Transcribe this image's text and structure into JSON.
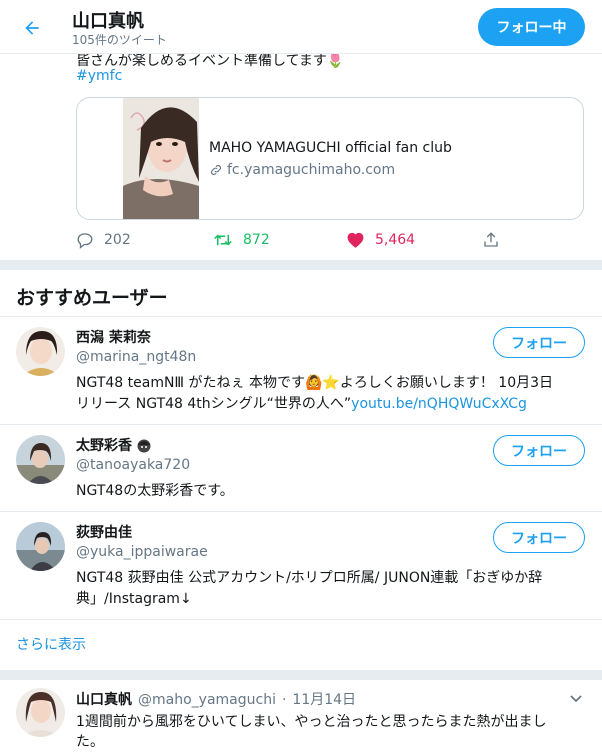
{
  "header": {
    "title": "山口真帆",
    "subtitle": "105件のツイート",
    "follow_label": "フォロー中"
  },
  "tweet": {
    "cut_text": "皆さんが楽しめるイベント準備してます🌷",
    "hashtag": "#ymfc",
    "card": {
      "title": "MAHO YAMAGUCHI official fan club",
      "domain": "fc.yamaguchimaho.com"
    },
    "replies": "202",
    "retweets": "872",
    "likes": "5,464"
  },
  "recommended": {
    "title": "おすすめユーザー",
    "more_label": "さらに表示",
    "users": [
      {
        "name": "西潟 茉莉奈",
        "handle": "@marina_ngt48n",
        "follow_label": "フォロー",
        "bio_line1": "NGT48 teamNⅢ がたねぇ 本物です🙆⭐よろしくお願いします！ 10月3日",
        "bio_line2_text": "リリース NGT48 4thシングル“世界の人へ”",
        "bio_link": "youtu.be/nQHQWuCxXCg"
      },
      {
        "name": "太野彩香",
        "handle": "@tanoayaka720",
        "follow_label": "フォロー",
        "bio_line1": "NGT48の太野彩香です。"
      },
      {
        "name": "荻野由佳",
        "handle": "@yuka_ippaiwarae",
        "follow_label": "フォロー",
        "bio_line1": "NGT48 荻野由佳 公式アカウント/ホリプロ所属/ JUNON連載「おぎゆか辞",
        "bio_line2_text": "典」/Instagram↓"
      }
    ]
  },
  "bottom_tweet": {
    "name": "山口真帆",
    "handle": "@maho_yamaguchi",
    "dot": "·",
    "date": "11月14日",
    "text_line1": "1週間前から風邪をひいてしまい、やっと治ったと思ったらまた熱が出まし",
    "text_line2": "た。"
  },
  "colors": {
    "accent": "#1da1f2",
    "link": "#1b95e0",
    "retweet": "#17bf63",
    "like": "#e0245e",
    "muted": "#657786",
    "divider": "#e6ecf0"
  },
  "icons": [
    "back-arrow-icon",
    "link-icon",
    "reply-icon",
    "retweet-icon",
    "heart-icon",
    "share-icon",
    "chevron-down-icon"
  ]
}
